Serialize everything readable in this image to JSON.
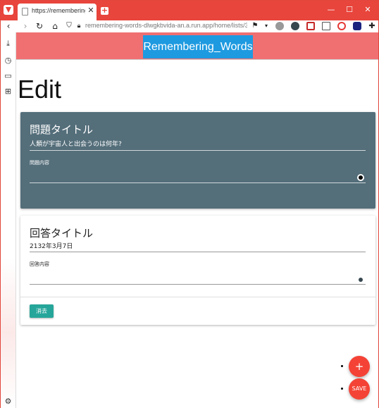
{
  "browser": {
    "tab_title": "https://remembering-",
    "tab_close": "✕",
    "new_tab": "+",
    "url": "remembering-words-dlwgkbvida-an.a.run.app/home/lists/3/...",
    "controls": {
      "minimize": "—",
      "maximize": "☐",
      "close": "✕"
    }
  },
  "app": {
    "title": "Remembering_Words"
  },
  "page": {
    "title": "Edit"
  },
  "question": {
    "title": "問題タイトル",
    "value": "人類が宇宙人と出会うのは何年?",
    "content_label": "問題内容"
  },
  "answer": {
    "title": "回答タイトル",
    "value": "2132年3月7日",
    "content_label": "回答内容",
    "delete_label": "消去"
  },
  "fabs": {
    "add_label": "+",
    "save_label": "SAVE"
  },
  "colors": {
    "browser_accent": "#e8453c",
    "header_bg": "#f07072",
    "title_bg": "#1e9ae0",
    "question_card": "#546e7a",
    "delete_button": "#26a69a",
    "fab": "#f44336"
  }
}
